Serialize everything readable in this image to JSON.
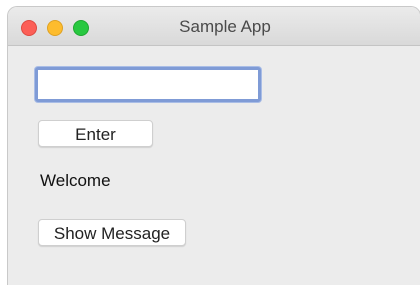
{
  "window": {
    "title": "Sample App"
  },
  "form": {
    "input_value": "",
    "input_placeholder": "",
    "enter_label": "Enter",
    "welcome_text": "Welcome",
    "show_message_label": "Show Message"
  },
  "colors": {
    "close": "#fc5f57",
    "minimize": "#fdbc2e",
    "zoom": "#28c840",
    "focus_ring": "#7f9bd6"
  }
}
